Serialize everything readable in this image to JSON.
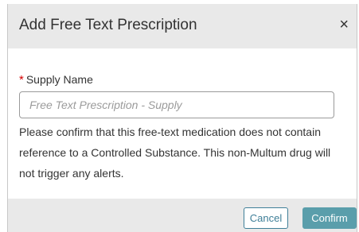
{
  "dialog": {
    "title": "Add Free Text Prescription",
    "close_symbol": "×",
    "field": {
      "required_marker": "*",
      "label": "Supply Name",
      "value": "",
      "placeholder": "Free Text Prescription - Supply"
    },
    "note": "Please confirm that this free-text medication does not contain reference to a Controlled Substance. This non-Multum drug will not trigger any alerts.",
    "buttons": {
      "cancel": "Cancel",
      "confirm": "Confirm"
    }
  },
  "colors": {
    "header_bg": "#e9e9e9",
    "required": "#d40000",
    "cancel_text": "#3f7f98",
    "confirm_bg": "#5a9eab"
  },
  "icons": {
    "close": "close-icon"
  }
}
